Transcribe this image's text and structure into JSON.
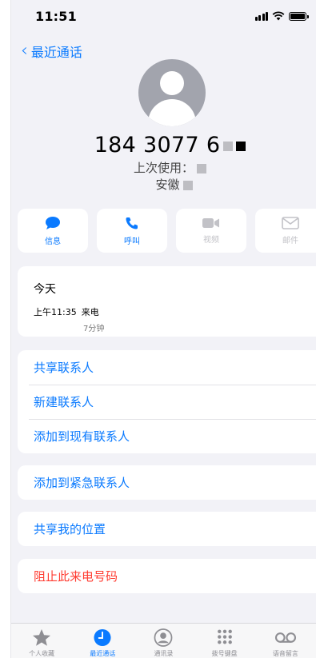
{
  "status_bar": {
    "time": "11:51"
  },
  "nav": {
    "back_label": "最近通话"
  },
  "contact": {
    "number_visible": "184 3077 6",
    "last_used_label": "上次使用：",
    "sim_label": "安徽"
  },
  "actions": [
    {
      "label": "信息",
      "icon": "message-icon",
      "enabled": true
    },
    {
      "label": "呼叫",
      "icon": "phone-icon",
      "enabled": true
    },
    {
      "label": "视频",
      "icon": "video-icon",
      "enabled": false
    },
    {
      "label": "邮件",
      "icon": "mail-icon",
      "enabled": false
    }
  ],
  "recents": {
    "title": "今天",
    "time": "上午11:35",
    "type": "来电",
    "duration": "7分钟"
  },
  "contact_options": [
    "共享联系人",
    "新建联系人",
    "添加到现有联系人"
  ],
  "emergency_label": "添加到紧急联系人",
  "share_location_label": "共享我的位置",
  "block_label": "阻止此来电号码",
  "tabs": [
    {
      "label": "个人收藏",
      "icon": "star-icon",
      "active": false
    },
    {
      "label": "最近通话",
      "icon": "clock-icon",
      "active": true
    },
    {
      "label": "通讯录",
      "icon": "contacts-icon",
      "active": false
    },
    {
      "label": "拨号键盘",
      "icon": "keypad-icon",
      "active": false
    },
    {
      "label": "语音留言",
      "icon": "voicemail-icon",
      "active": false
    }
  ],
  "colors": {
    "accent": "#0a7aff",
    "danger": "#ff3b30",
    "background": "#f2f2f7"
  }
}
